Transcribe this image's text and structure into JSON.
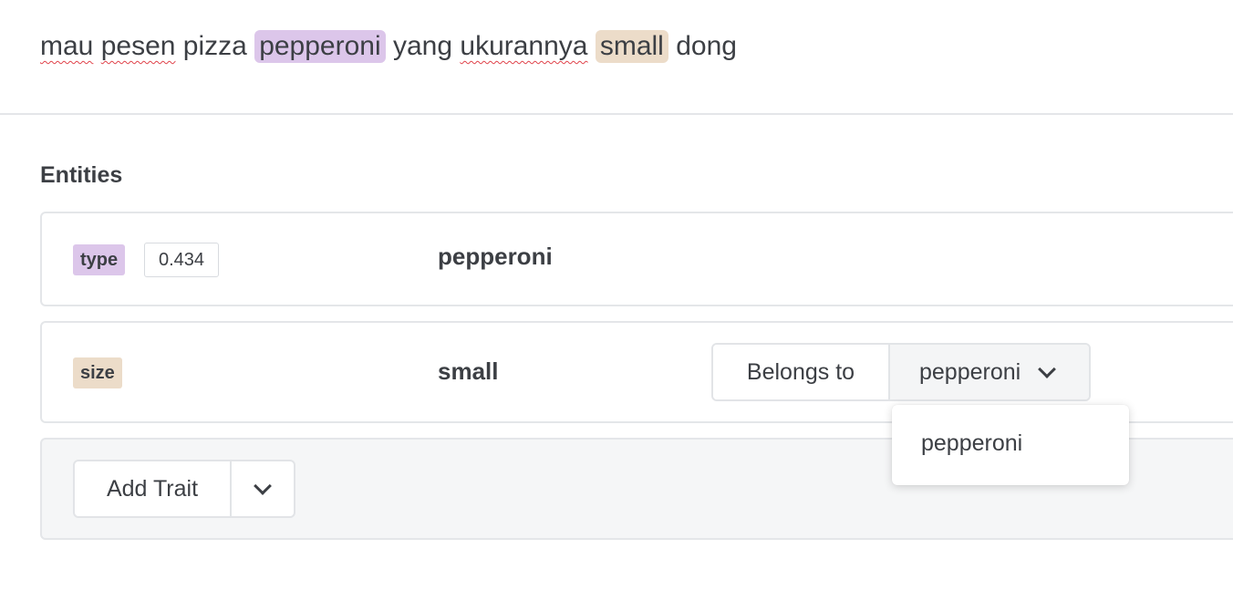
{
  "utterance": {
    "words": [
      {
        "text": "mau",
        "spell": true
      },
      {
        "text": "pesen",
        "spell": true
      },
      {
        "text": "pizza",
        "spell": false
      },
      {
        "text": "pepperoni",
        "highlight": "type"
      },
      {
        "text": "yang",
        "spell": false
      },
      {
        "text": "ukurannya",
        "spell": true
      },
      {
        "text": "small",
        "highlight": "size"
      },
      {
        "text": "dong",
        "spell": false
      }
    ]
  },
  "colors": {
    "type_tag": "#dcc6ea",
    "size_tag": "#ecdcc9",
    "text": "#3c3f44"
  },
  "entities_section": {
    "title": "Entities",
    "items": [
      {
        "tag": "type",
        "confidence": "0.434",
        "value": "pepperoni"
      },
      {
        "tag": "size",
        "value": "small",
        "belongs_to_label": "Belongs to",
        "belongs_to_value": "pepperoni",
        "belongs_icon": "chevron-down-icon"
      }
    ]
  },
  "dropdown": {
    "options": [
      "pepperoni"
    ]
  },
  "add_trait": {
    "label": "Add Trait",
    "toggle_icon": "chevron-down-icon"
  }
}
